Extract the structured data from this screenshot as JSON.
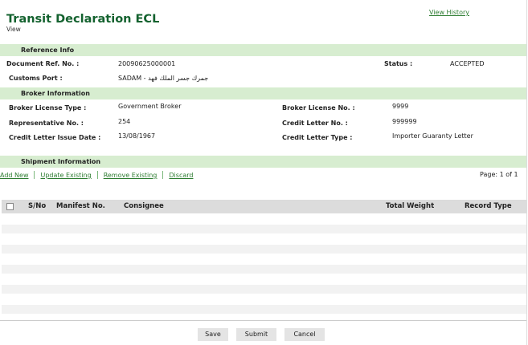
{
  "page": {
    "title": "Transit Declaration ECL",
    "subtitle": "View",
    "view_history": "View History"
  },
  "reference": {
    "heading": "Reference Info",
    "doc_ref_label": "Document Ref. No. :",
    "doc_ref_value": "20090625000001",
    "status_label": "Status :",
    "status_value": "ACCEPTED",
    "customs_port_label": "Customs Port :",
    "customs_port_value": "SADAM - جمرك جسر الملك فهد"
  },
  "broker": {
    "heading": "Broker Information",
    "license_type_label": "Broker License Type :",
    "license_type_value": "Government Broker",
    "license_no_label": "Broker License No. :",
    "license_no_value": "9999",
    "rep_no_label": "Representative No. :",
    "rep_no_value": "254",
    "credit_no_label": "Credit Letter No. :",
    "credit_no_value": "999999",
    "issue_date_label": "Credit Letter Issue Date :",
    "issue_date_value": "13/08/1967",
    "credit_type_label": "Credit Letter Type :",
    "credit_type_value": "Importer Guaranty Letter"
  },
  "shipment": {
    "heading": "Shipment Information",
    "actions": {
      "add_new": "Add New",
      "update_existing": "Update Existing",
      "remove_existing": "Remove Existing",
      "discard": "Discard"
    },
    "page_text": "Page:  1  of  1",
    "columns": {
      "sno": "S/No",
      "manifest": "Manifest No.",
      "consignee": "Consignee",
      "weight": "Total Weight",
      "record_type": "Record Type"
    }
  },
  "buttons": {
    "save": "Save",
    "submit": "Submit",
    "cancel": "Cancel"
  },
  "colors": {
    "title_green": "#14622f",
    "section_bg": "#d7edd0",
    "link_green": "#2e7d32",
    "table_header_bg": "#dcdcdc"
  }
}
